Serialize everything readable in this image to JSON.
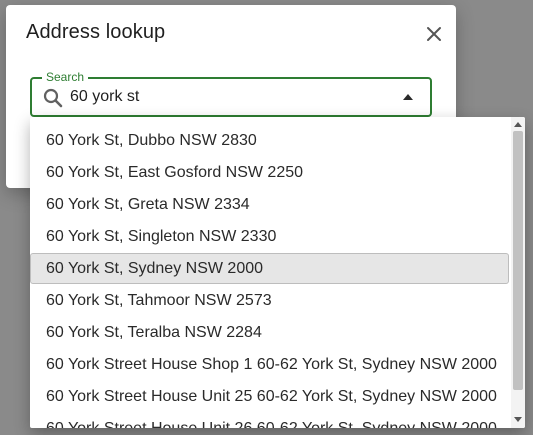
{
  "dialog": {
    "title": "Address lookup",
    "close_icon": "close-icon"
  },
  "search": {
    "label": "Search",
    "value": "60 york st",
    "icon": "search-icon",
    "toggle_icon": "caret-up-icon"
  },
  "results": {
    "options": [
      "60 York St, Dubbo NSW 2830",
      "60 York St, East Gosford NSW 2250",
      "60 York St, Greta NSW 2334",
      "60 York St, Singleton NSW 2330",
      "60 York St, Sydney NSW 2000",
      "60 York St, Tahmoor NSW 2573",
      "60 York St, Teralba NSW 2284",
      "60 York Street House Shop 1 60-62 York St, Sydney NSW 2000",
      "60 York Street House Unit 25 60-62 York St, Sydney NSW 2000",
      "60 York Street House Unit 26 60-62 York St, Sydney NSW 2000"
    ],
    "selected_index": 4
  },
  "colors": {
    "accent": "#2e7d32",
    "selected_bg": "#e6e6e6",
    "backdrop": "#8a8a8a"
  }
}
